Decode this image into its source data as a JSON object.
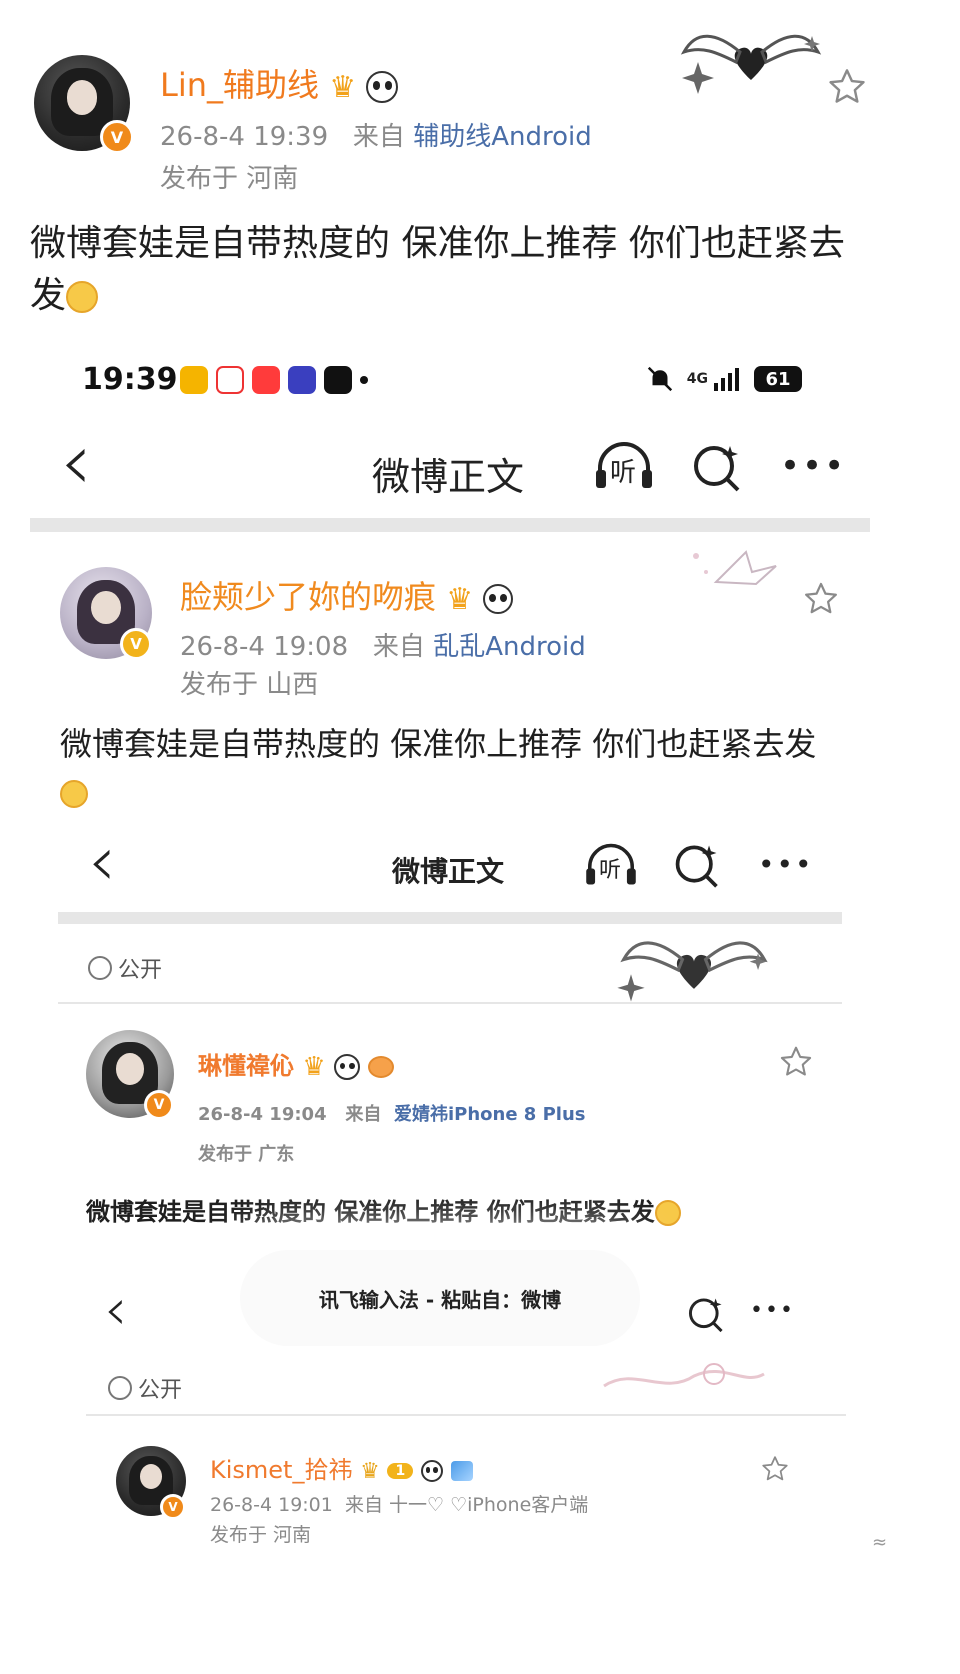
{
  "outer_post": {
    "username": "Lin_辅助线",
    "date": "26-8-4 19:39",
    "from_label": "来自",
    "source": "辅助线Android",
    "location": "发布于 河南",
    "text": "微博套娃是自带热度的 保准你上推荐 你们也赶紧去发"
  },
  "statusbar": {
    "time": "19:39",
    "network": "4G",
    "battery": "61",
    "colors": {
      "app1": "#f5b400",
      "app2": "#ffffff",
      "app3": "#ff3b3b",
      "app4": "#3a3fbf",
      "app5": "#111111"
    }
  },
  "navbar": {
    "back_glyph": "‹",
    "title": "微博正文",
    "listen_label": "听",
    "more_glyph": "•••"
  },
  "post2": {
    "username": "脸颊少了妳的吻痕",
    "date": "26-8-4 19:08",
    "from_label": "来自",
    "source": "乱乱Android",
    "location": "发布于 山西",
    "text": "微博套娃是自带热度的 保准你上推荐 你们也赶紧去发"
  },
  "navbar2": {
    "title": "微博正文",
    "listen_label": "听"
  },
  "public_label": "公开",
  "post3": {
    "username": "琳懂禕伈",
    "date": "26-8-4  19:04",
    "from_label": "来自",
    "source": "爱婧祎iPhone 8 Plus",
    "location": "发布于 广东",
    "text": "微博套娃是自带热度的 保准你上推荐 你们也赶紧去发"
  },
  "toast": {
    "text": "讯飞输入法 - 粘贴自：微博"
  },
  "public_label2": "公开",
  "post4": {
    "username": "Kismet_拾祎",
    "level": "1",
    "date": "26-8-4 19:01",
    "from_label": "来自",
    "source": "十一♡ ♡iPhone客户端",
    "location": "发布于 河南"
  },
  "corner_mark": "≈"
}
